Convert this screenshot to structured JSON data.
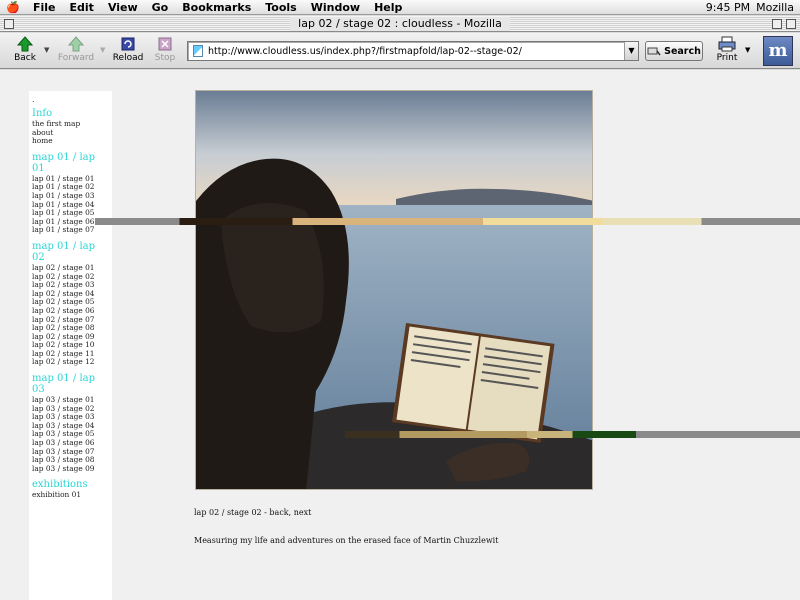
{
  "menubar": {
    "apple_label": "🍎",
    "items": [
      "File",
      "Edit",
      "View",
      "Go",
      "Bookmarks",
      "Tools",
      "Window",
      "Help"
    ],
    "clock": "9:45 PM",
    "app_name": "Mozilla"
  },
  "window": {
    "title": "lap 02 / stage 02 : cloudless - Mozilla"
  },
  "toolbar": {
    "back_label": "Back",
    "forward_label": "Forward",
    "reload_label": "Reload",
    "stop_label": "Stop",
    "url": "http://www.cloudless.us/index.php?/firstmapfold/lap-02--stage-02/",
    "search_label": "Search",
    "print_label": "Print",
    "throbber_label": "m"
  },
  "sidebar": {
    "dot": ".",
    "info": {
      "heading": "Info",
      "links": [
        "the first map",
        "about",
        "home"
      ]
    },
    "lap01": {
      "heading": "map 01 / lap 01",
      "links": [
        "lap 01 / stage 01",
        "lap 01 / stage 02",
        "lap 01 / stage 03",
        "lap 01 / stage 04",
        "lap 01 / stage 05",
        "lap 01 / stage 06",
        "lap 01 / stage 07"
      ]
    },
    "lap02": {
      "heading": "map 01 / lap 02",
      "links": [
        "lap 02 / stage 01",
        "lap 02 / stage 02",
        "lap 02 / stage 03",
        "lap 02 / stage 04",
        "lap 02 / stage 05",
        "lap 02 / stage 06",
        "lap 02 / stage 07",
        "lap 02 / stage 08",
        "lap 02 / stage 09",
        "lap 02 / stage 10",
        "lap 02 / stage 11",
        "lap 02 / stage 12"
      ]
    },
    "lap03": {
      "heading": "map 01 / lap 03",
      "links": [
        "lap 03 / stage 01",
        "lap 03 / stage 02",
        "lap 03 / stage 03",
        "lap 03 / stage 04",
        "lap 03 / stage 05",
        "lap 03 / stage 06",
        "lap 03 / stage 07",
        "lap 03 / stage 08",
        "lap 03 / stage 09"
      ]
    },
    "exhibitions": {
      "heading": "exhibitions",
      "links": [
        "exhibition 01"
      ]
    }
  },
  "main": {
    "caption_prefix": "lap 02 / stage 02 - ",
    "back_link": "back",
    "separator": ", ",
    "next_link": "next",
    "description": "Measuring my life and adventures on the erased face of Martin Chuzzlewit"
  },
  "colors": {
    "accent_cyan": "#2cd4d4",
    "page_bg": "#f0f0f0"
  }
}
